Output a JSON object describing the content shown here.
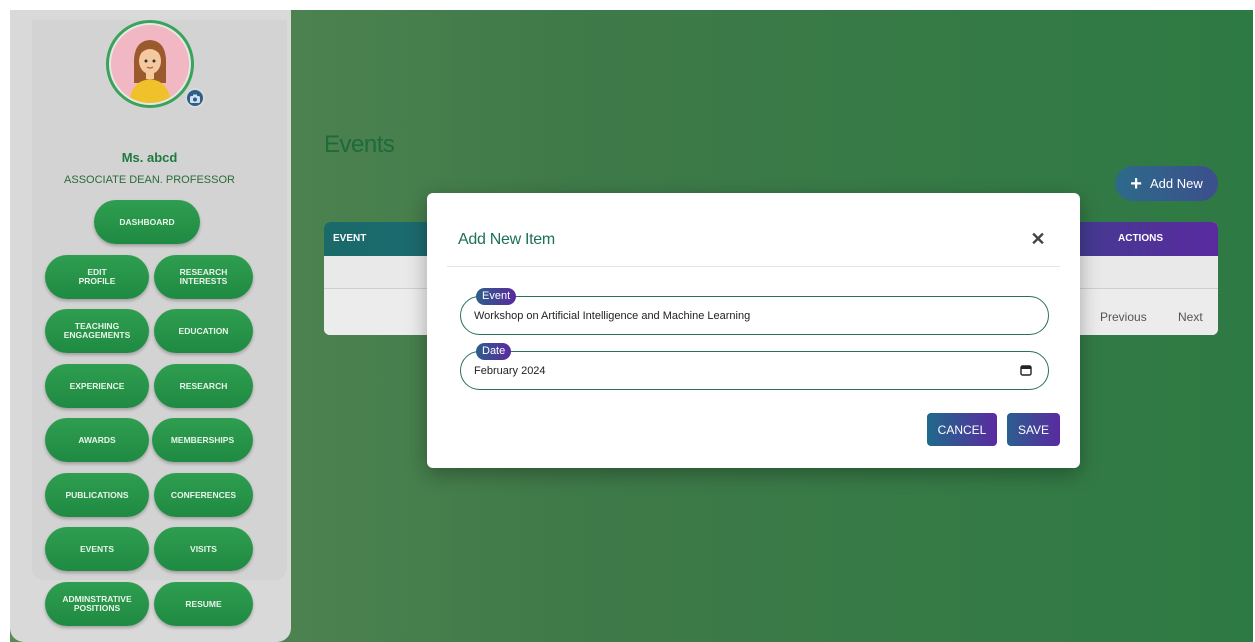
{
  "sidebar": {
    "profile_name": "Ms. abcd",
    "profile_role": "ASSOCIATE DEAN. PROFESSOR",
    "nav": {
      "dashboard": "DASHBOARD",
      "edit_profile": "EDIT\nPROFILE",
      "research_interests": "RESEARCH\nINTERESTS",
      "teaching_engagements": "TEACHING\nENGAGEMENTS",
      "education": "EDUCATION",
      "experience": "EXPERIENCE",
      "research": "RESEARCH",
      "awards": "AWARDS",
      "memberships": "MEMBERSHIPS",
      "publications": "PUBLICATIONS",
      "conferences": "CONFERENCES",
      "events": "EVENTS",
      "visits": "VISITS",
      "administrative_positions": "ADMINSTRATIVE\nPOSITIONS",
      "resume": "RESUME"
    }
  },
  "main": {
    "title": "Events",
    "add_new_label": "Add New",
    "table": {
      "col_event": "EVENT",
      "col_actions": "ACTIONS"
    },
    "pager": {
      "previous": "Previous",
      "next": "Next"
    }
  },
  "modal": {
    "title": "Add New Item",
    "event_label": "Event",
    "event_value": "Workshop on Artificial Intelligence and Machine Learning",
    "date_label": "Date",
    "date_value": "February 2024",
    "cancel_label": "CANCEL",
    "save_label": "SAVE"
  }
}
